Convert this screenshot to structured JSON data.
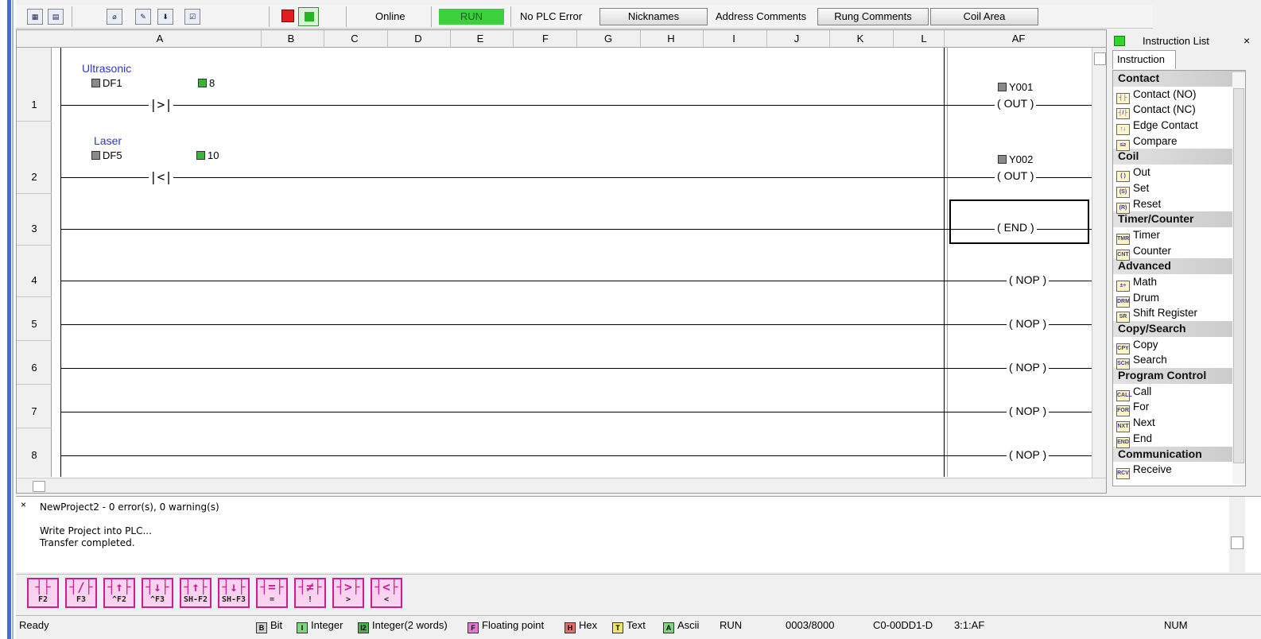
{
  "toolbar": {
    "status_online": "Online",
    "status_run": "RUN",
    "status_error": "No PLC Error",
    "buttons": [
      "Nicknames",
      "Address Comments",
      "Rung Comments",
      "Coil Area"
    ]
  },
  "ladder": {
    "columns": [
      "A",
      "B",
      "C",
      "D",
      "E",
      "F",
      "G",
      "H",
      "I",
      "J",
      "K",
      "L",
      "AF"
    ],
    "rung_numbers": [
      "1",
      "2",
      "3",
      "4",
      "5",
      "6",
      "7",
      "8"
    ],
    "rungs": [
      {
        "nickname": "Ultrasonic",
        "address": "DF1",
        "compare_value": "8",
        "compare_op": "|>|",
        "coil_address": "Y001",
        "coil": "OUT"
      },
      {
        "nickname": "Laser",
        "address": "DF5",
        "compare_value": "10",
        "compare_op": "|<|",
        "coil_address": "Y002",
        "coil": "OUT"
      }
    ],
    "end_coil": "END",
    "nop_coil": "( NOP )"
  },
  "instruction_panel": {
    "title": "Instruction List",
    "tab": "Instruction",
    "groups": [
      {
        "category": "Contact",
        "items": [
          "Contact (NO)",
          "Contact (NC)",
          "Edge Contact",
          "Compare"
        ]
      },
      {
        "category": "Coil",
        "items": [
          "Out",
          "Set",
          "Reset"
        ]
      },
      {
        "category": "Timer/Counter",
        "items": [
          "Timer",
          "Counter"
        ]
      },
      {
        "category": "Advanced",
        "items": [
          "Math",
          "Drum",
          "Shift Register"
        ]
      },
      {
        "category": "Copy/Search",
        "items": [
          "Copy",
          "Search"
        ]
      },
      {
        "category": "Program Control",
        "items": [
          "Call",
          "For",
          "Next",
          "End"
        ]
      },
      {
        "category": "Communication",
        "items": [
          "Receive"
        ]
      }
    ]
  },
  "output": {
    "header": "NewProject2 - 0 error(s), 0 warning(s)",
    "lines": [
      "Write Project into PLC...",
      "Transfer completed."
    ]
  },
  "instruction_buttons": [
    {
      "symbol": "┤├",
      "key": "F2"
    },
    {
      "symbol": "┤/├",
      "key": "F3"
    },
    {
      "symbol": "┤↑├",
      "key": "^F2"
    },
    {
      "symbol": "┤↓├",
      "key": "^F3"
    },
    {
      "symbol": "┤↑├",
      "key": "SH-F2"
    },
    {
      "symbol": "┤↓├",
      "key": "SH-F3"
    },
    {
      "symbol": "┤=├",
      "key": "="
    },
    {
      "symbol": "┤≠├",
      "key": "!"
    },
    {
      "symbol": "┤>├",
      "key": ">"
    },
    {
      "symbol": "┤<├",
      "key": "<"
    }
  ],
  "status_bar": {
    "ready": "Ready",
    "legend": [
      "Bit",
      "Integer",
      "Integer(2 words)",
      "Floating point",
      "Hex",
      "Text",
      "Ascii"
    ],
    "mode": "RUN",
    "steps": "0003/8000",
    "plc": "C0-00DD1-D",
    "cursor": "3:1:AF",
    "num": "NUM"
  }
}
